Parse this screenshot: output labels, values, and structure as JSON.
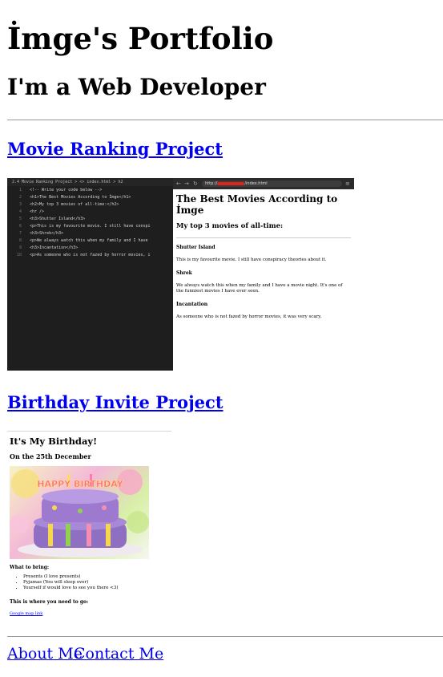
{
  "header": {
    "title": "İmge's Portfolio",
    "subtitle": "I'm a Web Developer"
  },
  "projects": [
    {
      "link_text": "Movie Ranking Project",
      "screenshot": {
        "editor_breadcrumb": "2.4 Movie Ranking Project > <> index.html > h2",
        "line_numbers": [
          "1",
          "2",
          "3",
          "4",
          "5",
          "6",
          "7",
          "8",
          "9",
          "10"
        ],
        "code_lines": [
          "<!-- Write your code below -->",
          "<h1>The Best Movies According to İmge</h1>",
          "<h2>My top 3 movies of all-time:</h2>",
          "<hr />",
          "<h3>Shutter Island</h3>",
          "<p>This is my favourite movie. I still have conspi",
          "<h3>Shrek</h3>",
          "<p>We always watch this when my family and I have",
          "<h3>Incantation</h3>",
          "<p>As someone who is not fazed by horror movies, i"
        ],
        "url_prefix": "http://",
        "url_suffix": "/index.html",
        "page_h1": "The Best Movies According to İmge",
        "page_h2": "My top 3 movies of all-time:",
        "movies": [
          {
            "title": "Shutter Island",
            "text": "This is my favourite movie. I still have conspiracy theories about it."
          },
          {
            "title": "Shrek",
            "text": "We always watch this when my family and I have a movie night. It's one of the funniest movies I have ever seen."
          },
          {
            "title": "Incantation",
            "text": "As someone who is not fazed by horror movies, it was very scary."
          }
        ]
      }
    },
    {
      "link_text": "Birthday Invite Project",
      "screenshot": {
        "h1": "It's My Birthday!",
        "h2": "On the 25th December",
        "cake_text": "HAPPY BIRTHDAY",
        "bring_heading": "What to bring:",
        "bring_items": [
          "Presents (I love presents)",
          "Pyjamas (You will sleep over)",
          "Yourself if would love to see you there <3)"
        ],
        "where_heading": "This is where you need to go:",
        "map_link": "Google map link"
      }
    }
  ],
  "footer": {
    "about_link": "About Me",
    "contact_link": "Contact Me"
  }
}
